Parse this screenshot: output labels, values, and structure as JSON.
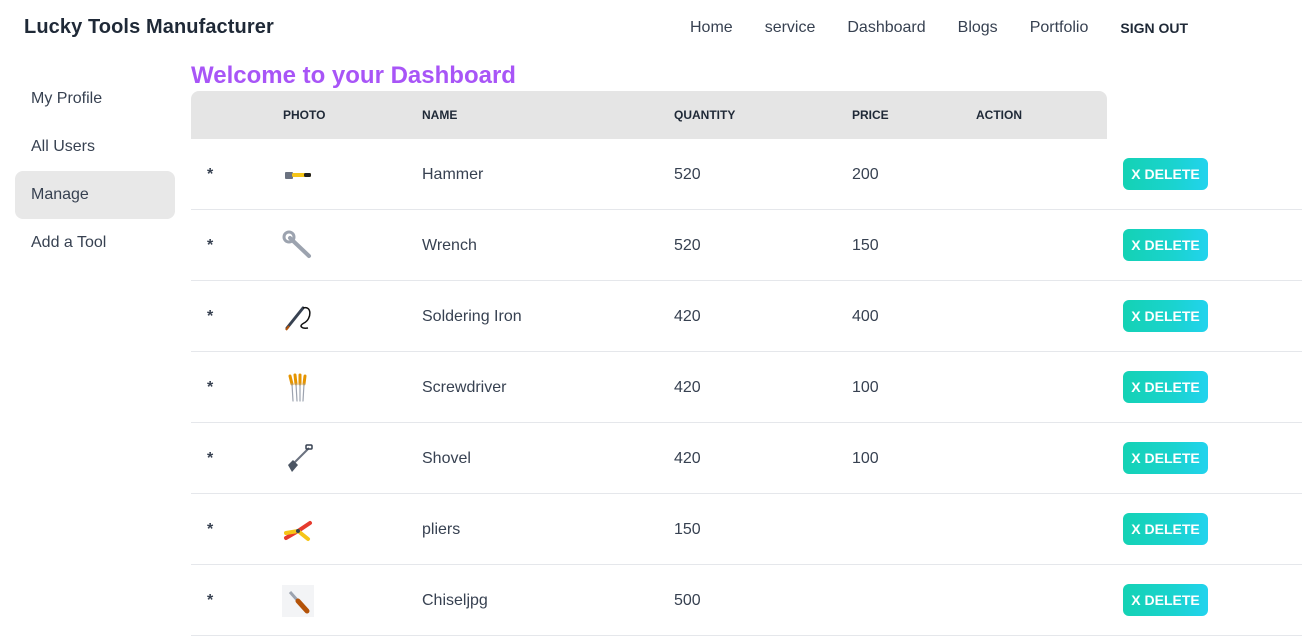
{
  "brand": "Lucky Tools Manufacturer",
  "nav": [
    "Home",
    "service",
    "Dashboard",
    "Blogs",
    "Portfolio"
  ],
  "signout": "SIGN OUT",
  "sidebar": [
    {
      "label": "My Profile",
      "active": false
    },
    {
      "label": "All Users",
      "active": false
    },
    {
      "label": "Manage",
      "active": true
    },
    {
      "label": "Add a Tool",
      "active": false
    }
  ],
  "title": "Welcome to your Dashboard",
  "columns": {
    "photo": "PHOTO",
    "name": "NAME",
    "quantity": "QUANTITY",
    "price": "PRICE",
    "action": "ACTION"
  },
  "rows": [
    {
      "marker": "*",
      "icon": "hammer-icon",
      "name": "Hammer",
      "quantity": "520",
      "price": "200"
    },
    {
      "marker": "*",
      "icon": "wrench-icon",
      "name": "Wrench",
      "quantity": "520",
      "price": "150"
    },
    {
      "marker": "*",
      "icon": "soldering-iron-icon",
      "name": "Soldering Iron",
      "quantity": "420",
      "price": "400"
    },
    {
      "marker": "*",
      "icon": "screwdriver-icon",
      "name": "Screwdriver",
      "quantity": "420",
      "price": "100"
    },
    {
      "marker": "*",
      "icon": "shovel-icon",
      "name": "Shovel",
      "quantity": "420",
      "price": "100"
    },
    {
      "marker": "*",
      "icon": "pliers-icon",
      "name": "pliers",
      "quantity": "150",
      "price": ""
    },
    {
      "marker": "*",
      "icon": "chisel-icon",
      "name": "Chiseljpg",
      "quantity": "500",
      "price": ""
    }
  ],
  "delete_label": "X DELETE",
  "colors": {
    "title": "#a855f7",
    "delete_button": "#19d3c5",
    "active_sidebar": "#e8e8e8",
    "table_header": "#e5e5e5"
  }
}
